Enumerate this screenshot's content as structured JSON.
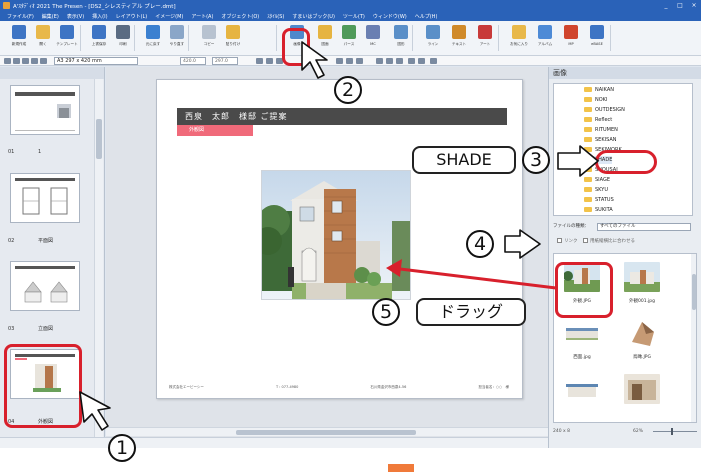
{
  "window": {
    "title": "A'ｽﾀﾃﾞｨｵ 2021 The Presen - [DS2_シレスティアル プレー.dmt]",
    "controls": [
      "_",
      "□",
      "×"
    ]
  },
  "menu": [
    "ファイル(F)",
    "編集(E)",
    "表示(V)",
    "挿入(I)",
    "レイアウト(L)",
    "イメージ(M)",
    "アート(A)",
    "オブジェクト(O)",
    "ｽﾀｲﾙ(S)",
    "すまいはブック(U)",
    "ツール(T)",
    "ウィンドウ(W)",
    "ヘルプ(H)"
  ],
  "ribbon": [
    {
      "label": "新規作成",
      "color": "#3d74c4"
    },
    {
      "label": "開く",
      "color": "#e8b84a"
    },
    {
      "label": "テンプレート",
      "color": "#3d74c4"
    },
    {
      "label": "上書保存",
      "color": "#3d74c4"
    },
    {
      "label": "印刷",
      "color": "#5a6b82"
    },
    {
      "label": "元に戻す",
      "color": "#3b80d0"
    },
    {
      "label": "やり直す",
      "color": "#8aa6c8"
    },
    {
      "label": "コピー",
      "color": "#b7c2d0"
    },
    {
      "label": "貼り付け",
      "color": "#e6b441"
    },
    {
      "label": "画像",
      "color": "#4f88cc"
    },
    {
      "label": "図面",
      "color": "#e6b441"
    },
    {
      "label": "パース",
      "color": "#4f9a5a"
    },
    {
      "label": "MC",
      "color": "#6a7fb2"
    },
    {
      "label": "図形",
      "color": "#5a8fc8"
    },
    {
      "label": "ライン",
      "color": "#5a8fc8"
    },
    {
      "label": "テキスト",
      "color": "#d08a2a"
    },
    {
      "label": "アート",
      "color": "#c83a3a"
    },
    {
      "label": "お気に入り",
      "color": "#e8b84a"
    },
    {
      "label": "アルバム",
      "color": "#4d8ad6"
    },
    {
      "label": "MP",
      "color": "#d0452e"
    },
    {
      "label": "eBASE",
      "color": "#3d74c4"
    }
  ],
  "options": {
    "paper": "A3 297 x 420 mm",
    "width": "420.0",
    "height": "297.0"
  },
  "pages": [
    {
      "num": "01",
      "label": "1"
    },
    {
      "num": "02",
      "label": "平面図"
    },
    {
      "num": "03",
      "label": "立面図"
    },
    {
      "num": "04",
      "label": "外観図"
    }
  ],
  "document": {
    "header": "西泉　太郎　様邸 ご提案",
    "tag": "外観図",
    "footer_left": "株式会社エービーシー",
    "footer_tel": "T : 077-4980",
    "footer_addr": "石川県金沢市西泉4-56",
    "footer_right": "担当者名：○○　様"
  },
  "image_panel": {
    "tab": "画像",
    "folders": [
      "NAIKAN",
      "NOKI",
      "OUTDESIGN",
      "Reflect",
      "RITUMEN",
      "SEKISAN",
      "SEKIWORK",
      "SHADE",
      "SHOUSAI",
      "SIAGE",
      "SKYU",
      "STATUS",
      "SUKITA"
    ],
    "selected_folder": "SHADE",
    "filter_label": "ファイルの種類：",
    "filter_value": "すべてのファイル",
    "link_label": "リンク",
    "fit_label": "用紙縦横比に合わせる",
    "thumbs": [
      {
        "name": "外観.JPG"
      },
      {
        "name": "外観001.jpg"
      },
      {
        "name": "西面.jpg"
      },
      {
        "name": "鳥瞰.JPG"
      },
      {
        "name": ""
      },
      {
        "name": ""
      }
    ],
    "status_size": "240 x 8",
    "zoom": "62%"
  },
  "annotations": {
    "step1": "1",
    "step2": "2",
    "step3": "3",
    "step4": "4",
    "step5": "5",
    "shade_callout": "SHADE",
    "drag_callout": "ドラッグ"
  },
  "colors": {
    "accent_red": "#d8202c",
    "header_bar": "#4a4a4a",
    "tag_pink": "#f06a7a",
    "title_blue": "#2a62b8"
  }
}
